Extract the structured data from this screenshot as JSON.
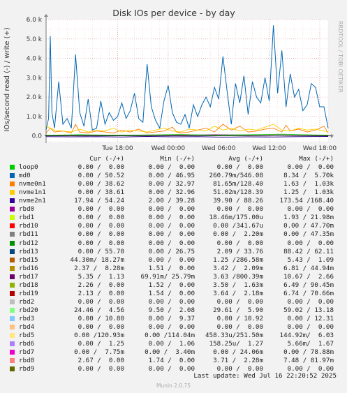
{
  "chart_data": {
    "type": "line",
    "title": "Disk IOs per device - by day",
    "ylabel": "IOs/second read (-) / write (+)",
    "ylim": [
      -300,
      6000
    ],
    "yticks": [
      {
        "v": 0,
        "l": "0.0"
      },
      {
        "v": 1000,
        "l": "1.0 k"
      },
      {
        "v": 2000,
        "l": "2.0 k"
      },
      {
        "v": 3000,
        "l": "3.0 k"
      },
      {
        "v": 4000,
        "l": "4.0 k"
      },
      {
        "v": 5000,
        "l": "5.0 k"
      },
      {
        "v": 6000,
        "l": "6.0 k"
      }
    ],
    "xrange_hours": [
      0,
      33.5
    ],
    "xticks": [
      {
        "h": 8.5,
        "l": "Tue 18:00"
      },
      {
        "h": 14.5,
        "l": "Wed 00:00"
      },
      {
        "h": 20.5,
        "l": "Wed 06:00"
      },
      {
        "h": 26.5,
        "l": "Wed 12:00"
      },
      {
        "h": 32.5,
        "l": "Wed 18:00"
      }
    ],
    "grid": true,
    "series": [
      {
        "name": "md0",
        "color": "#0066b3",
        "x": [
          0,
          0.3,
          0.5,
          0.7,
          1,
          1.5,
          2,
          2.5,
          3,
          3.5,
          4,
          4.5,
          5,
          5.5,
          6,
          6.5,
          7,
          7.5,
          8,
          8.5,
          9,
          9.5,
          10,
          10.5,
          11,
          11.5,
          12,
          12.5,
          13,
          13.5,
          14,
          14.5,
          15,
          15.5,
          16,
          16.5,
          17,
          17.5,
          18,
          18.5,
          19,
          19.5,
          20,
          20.5,
          21,
          21.5,
          22,
          22.5,
          23,
          23.5,
          24,
          24.5,
          25,
          25.5,
          26,
          26.5,
          27,
          27.5,
          28,
          28.5,
          29,
          29.5,
          30,
          30.5,
          31,
          31.5,
          32,
          32.5,
          33,
          33.5
        ],
        "y": [
          300,
          900,
          5150,
          1200,
          400,
          2800,
          600,
          900,
          400,
          4200,
          1200,
          500,
          1900,
          300,
          400,
          1800,
          600,
          1200,
          800,
          1000,
          1700,
          900,
          1300,
          2200,
          900,
          700,
          3700,
          1500,
          800,
          400,
          1800,
          2600,
          1200,
          700,
          600,
          1100,
          400,
          1600,
          1000,
          1600,
          2000,
          1500,
          2500,
          1900,
          4100,
          2300,
          600,
          2700,
          1700,
          3100,
          1100,
          2800,
          2000,
          1700,
          3000,
          1800,
          5700,
          2200,
          4400,
          1500,
          3200,
          2000,
          2400,
          1300,
          1600,
          2700,
          2500,
          1500,
          1500,
          400
        ]
      },
      {
        "name": "nvme0n1",
        "color": "#ff8000",
        "x": [
          0,
          0.5,
          1,
          2,
          3,
          3.5,
          4,
          5,
          6,
          7,
          8,
          9,
          10,
          11,
          12,
          13,
          14,
          15,
          15.5,
          16,
          17,
          18,
          19,
          20,
          21,
          22,
          23,
          24,
          25,
          26,
          27,
          28,
          28.5,
          29,
          30,
          31,
          32,
          33,
          33.5
        ],
        "y": [
          150,
          400,
          200,
          250,
          150,
          600,
          200,
          150,
          250,
          200,
          150,
          300,
          200,
          350,
          150,
          200,
          250,
          450,
          200,
          150,
          200,
          300,
          400,
          200,
          600,
          300,
          500,
          200,
          250,
          350,
          400,
          200,
          550,
          250,
          350,
          200,
          300,
          500,
          150
        ]
      },
      {
        "name": "nvme1n1",
        "color": "#ffcc00",
        "x": [
          0,
          1,
          2,
          3,
          4,
          5,
          6,
          7,
          8,
          9,
          10,
          11,
          12,
          13,
          14,
          15,
          16,
          17,
          18,
          19,
          20,
          21,
          22,
          23,
          24,
          25,
          26,
          27,
          28,
          29,
          30,
          31,
          32,
          33,
          33.5
        ],
        "y": [
          500,
          300,
          250,
          200,
          350,
          200,
          300,
          250,
          400,
          200,
          300,
          250,
          200,
          300,
          400,
          250,
          200,
          350,
          300,
          250,
          500,
          300,
          400,
          250,
          350,
          300,
          450,
          600,
          300,
          250,
          400,
          300,
          350,
          250,
          200
        ]
      },
      {
        "name": "nvme2n1",
        "color": "#330099",
        "x": [
          0,
          3,
          6,
          9,
          12,
          15,
          18,
          21,
          24,
          27,
          30,
          33.5
        ],
        "y": [
          -40,
          -50,
          -40,
          -60,
          -30,
          -50,
          -40,
          -70,
          -50,
          -60,
          -40,
          -30
        ]
      },
      {
        "name": "rbd16",
        "color": "#990099",
        "x": [
          0,
          4,
          8,
          12,
          16,
          20,
          24,
          28,
          32,
          33.5
        ],
        "y": [
          20,
          40,
          30,
          50,
          40,
          60,
          50,
          80,
          40,
          30
        ]
      },
      {
        "name": "rbd20",
        "color": "#00cc00",
        "x": [
          0,
          4,
          8,
          12,
          16,
          20,
          24,
          28,
          32,
          33.5
        ],
        "y": [
          30,
          60,
          40,
          50,
          70,
          40,
          60,
          90,
          50,
          40
        ]
      }
    ]
  },
  "side_label": "RRDTOOL / TOBI OETIKER",
  "legend": {
    "headers": {
      "cur": "Cur (-/+)",
      "min": "Min (-/+)",
      "avg": "Avg (-/+)",
      "max": "Max (-/+)"
    },
    "rows": [
      {
        "name": "loop0",
        "color": "#00cc00",
        "cur": "0.00 /  0.00",
        "min": "0.00 /  0.00",
        "avg": "0.00 /  0.00",
        "max": "0.00 /  0.00"
      },
      {
        "name": "md0",
        "color": "#0066b3",
        "cur": "0.00 / 50.52",
        "min": "0.00 / 46.95",
        "avg": "260.79m/546.08",
        "max": "8.34 /  5.70k"
      },
      {
        "name": "nvme0n1",
        "color": "#ff8000",
        "cur": "0.00 / 38.62",
        "min": "0.00 / 32.97",
        "avg": "81.65m/128.40",
        "max": "1.63 /  1.03k"
      },
      {
        "name": "nvme1n1",
        "color": "#ffcc00",
        "cur": "0.00 / 38.61",
        "min": "0.00 / 32.96",
        "avg": "51.02m/128.39",
        "max": "1.25 /  1.03k"
      },
      {
        "name": "nvme2n1",
        "color": "#330099",
        "cur": "17.94 / 54.24",
        "min": "2.00 / 39.28",
        "avg": "39.90 / 88.26",
        "max": "173.54 /168.40"
      },
      {
        "name": "rbd0",
        "color": "#990099",
        "cur": "0.00 /  0.00",
        "min": "0.00 /  0.00",
        "avg": "0.00 /  0.00",
        "max": "0.00 /  0.00"
      },
      {
        "name": "rbd1",
        "color": "#ccff00",
        "cur": "0.00 /  0.00",
        "min": "0.00 /  0.00",
        "avg": "18.46m/175.00u",
        "max": "1.93 / 21.98m"
      },
      {
        "name": "rbd10",
        "color": "#ff0000",
        "cur": "0.00 /  0.00",
        "min": "0.00 /  0.00",
        "avg": "0.00 /341.67u",
        "max": "0.00 / 47.70m"
      },
      {
        "name": "rbd11",
        "color": "#808080",
        "cur": "0.00 /  0.00",
        "min": "0.00 /  0.00",
        "avg": "0.00 /  2.20m",
        "max": "0.00 / 47.35m"
      },
      {
        "name": "rbd12",
        "color": "#008f00",
        "cur": "0.00 /  0.00",
        "min": "0.00 /  0.00",
        "avg": "0.00 /  0.00",
        "max": "0.00 /  0.00"
      },
      {
        "name": "rbd13",
        "color": "#00487d",
        "cur": "0.00 / 55.70",
        "min": "0.00 / 26.75",
        "avg": "2.09 / 33.76",
        "max": "88.42 / 62.11"
      },
      {
        "name": "rbd15",
        "color": "#b35a00",
        "cur": "44.30m/ 18.27m",
        "min": "0.00 /  0.00",
        "avg": "1.25 /286.58m",
        "max": "5.43 /  1.09"
      },
      {
        "name": "rbd16",
        "color": "#b38f00",
        "cur": "2.37 /  8.28m",
        "min": "1.51 /  0.00",
        "avg": "3.42 /  2.09m",
        "max": "6.81 / 44.94m"
      },
      {
        "name": "rbd17",
        "color": "#6b006b",
        "cur": "5.35 /  1.13",
        "min": "69.91m/ 25.79m",
        "avg": "3.63 /800.39m",
        "max": "10.67 /  2.66"
      },
      {
        "name": "rbd18",
        "color": "#8fb300",
        "cur": "2.26 /  0.00",
        "min": "1.52 /  0.00",
        "avg": "3.50 /  1.63m",
        "max": "6.49 / 90.45m"
      },
      {
        "name": "rbd19",
        "color": "#b30000",
        "cur": "2.13 /  0.00",
        "min": "1.54 /  0.00",
        "avg": "3.64 /  2.18m",
        "max": "6.74 / 70.66m"
      },
      {
        "name": "rbd2",
        "color": "#bebebe",
        "cur": "0.00 /  0.00",
        "min": "0.00 /  0.00",
        "avg": "0.00 /  0.00",
        "max": "0.00 /  0.00"
      },
      {
        "name": "rbd20",
        "color": "#80ff80",
        "cur": "24.46 /  4.56",
        "min": "9.50 /  2.08",
        "avg": "29.61 /  5.90",
        "max": "59.02 / 13.18"
      },
      {
        "name": "rbd3",
        "color": "#80c9ff",
        "cur": "0.00 / 10.80",
        "min": "0.00 /  9.37",
        "avg": "0.00 / 10.92",
        "max": "0.00 / 12.31"
      },
      {
        "name": "rbd4",
        "color": "#ffc080",
        "cur": "0.00 /  0.00",
        "min": "0.00 /  0.00",
        "avg": "0.00 /  0.00",
        "max": "0.00 /  0.00"
      },
      {
        "name": "rbd5",
        "color": "#ffe680",
        "cur": "0.00 /120.93m",
        "min": "0.00 /114.04m",
        "avg": "458.33u/251.50m",
        "max": "144.92m/  6.03"
      },
      {
        "name": "rbd6",
        "color": "#aa80ff",
        "cur": "0.00 /  1.25",
        "min": "0.00 /  1.06",
        "avg": "158.25u/  1.27",
        "max": "5.66m/  1.67"
      },
      {
        "name": "rbd7",
        "color": "#ee00cc",
        "cur": "0.00 /  7.75m",
        "min": "0.00 /  3.40m",
        "avg": "0.00 / 24.06m",
        "max": "0.00 / 78.88m"
      },
      {
        "name": "rbd8",
        "color": "#ff8080",
        "cur": "2.67 /  0.00",
        "min": "1.74 /  0.00",
        "avg": "3.71 /  2.28m",
        "max": "7.48 / 81.97m"
      },
      {
        "name": "rbd9",
        "color": "#666600",
        "cur": "0.00 /  0.00",
        "min": "0.00 /  0.00",
        "avg": "0.00 /  0.00",
        "max": "0.00 /  0.00"
      }
    ]
  },
  "footer": "Last update: Wed Jul 16 22:20:52 2025",
  "munin_version": "Munin 2.0.75"
}
